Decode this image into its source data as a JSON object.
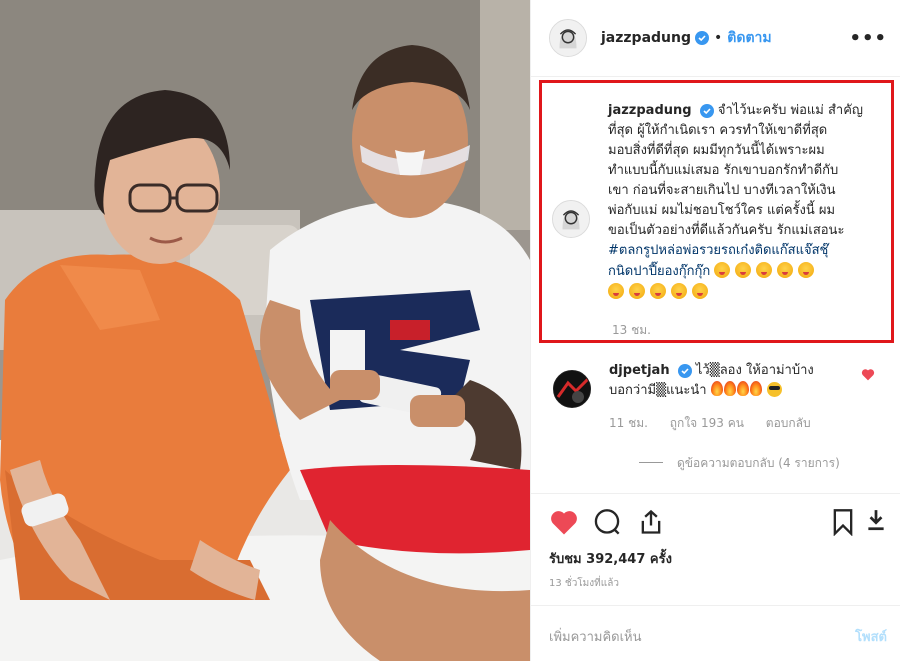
{
  "post": {
    "username": "jazzpadung",
    "follow_label": "ติดตาม",
    "dot": "•",
    "more_label": "•••"
  },
  "caption": {
    "username": "jazzpadung",
    "lines": [
      "จำไว้นะครับ พ่อแม่ สำคัญ",
      "ที่สุด ผู้ให้กำเนิดเรา ควรทำให้เขาดีที่สุด",
      "มอบสิ่งที่ดีที่สุด ผมมีทุกวันนี้ได้เพราะผม",
      "ทำแบบนี้กับแม่เสมอ รักเขาบอกรักทำดีกับ",
      "เขา ก่อนที่จะสายเกินไป บางทีเวลาให้เงิน",
      "พ่อกับแม่ ผมไม่ชอบโชว์ใคร แต่ครั้งนี้ ผม",
      "ขอเป็นตัวอย่างที่ดีแล้วกันครับ รักแม่เสอนะ"
    ],
    "hashtag_line1": "#ตลกรูปหล่อพ่อรวยรถเก๋งติดแก๊สแจ๊สชุ๊",
    "hashtag_line2": "กนิดปาปี๊ยองกุ๊กกุ๊ก",
    "time": "13 ชม."
  },
  "comment": {
    "username": "djpetjah",
    "text_line1": "ไว้▒ลอง ให้อาม่าบ้าง",
    "text_line2": "บอกว่ามี▒แนะนำ",
    "time": "11 ชม.",
    "likes": "ถูกใจ 193 คน",
    "reply_label": "ตอบกลับ",
    "view_replies": "ดูข้อความตอบกลับ (4 รายการ)"
  },
  "stats": {
    "views": "รับชม 392,447 ครั้ง",
    "ago": "13 ชั่วโมงที่แล้ว"
  },
  "composer": {
    "placeholder": "เพิ่มความคิดเห็น",
    "post_label": "โพสต์"
  },
  "icons": {
    "more": "more-options-icon",
    "verified": "verified-badge-icon",
    "like": "heart-icon",
    "comment": "comment-icon",
    "share": "share-icon",
    "save": "bookmark-icon",
    "download": "download-icon"
  },
  "colors": {
    "accent": "#3897f0",
    "highlight_border": "#e0171b",
    "like_red": "#ed4956",
    "hashtag": "#003569",
    "muted": "#999999"
  }
}
